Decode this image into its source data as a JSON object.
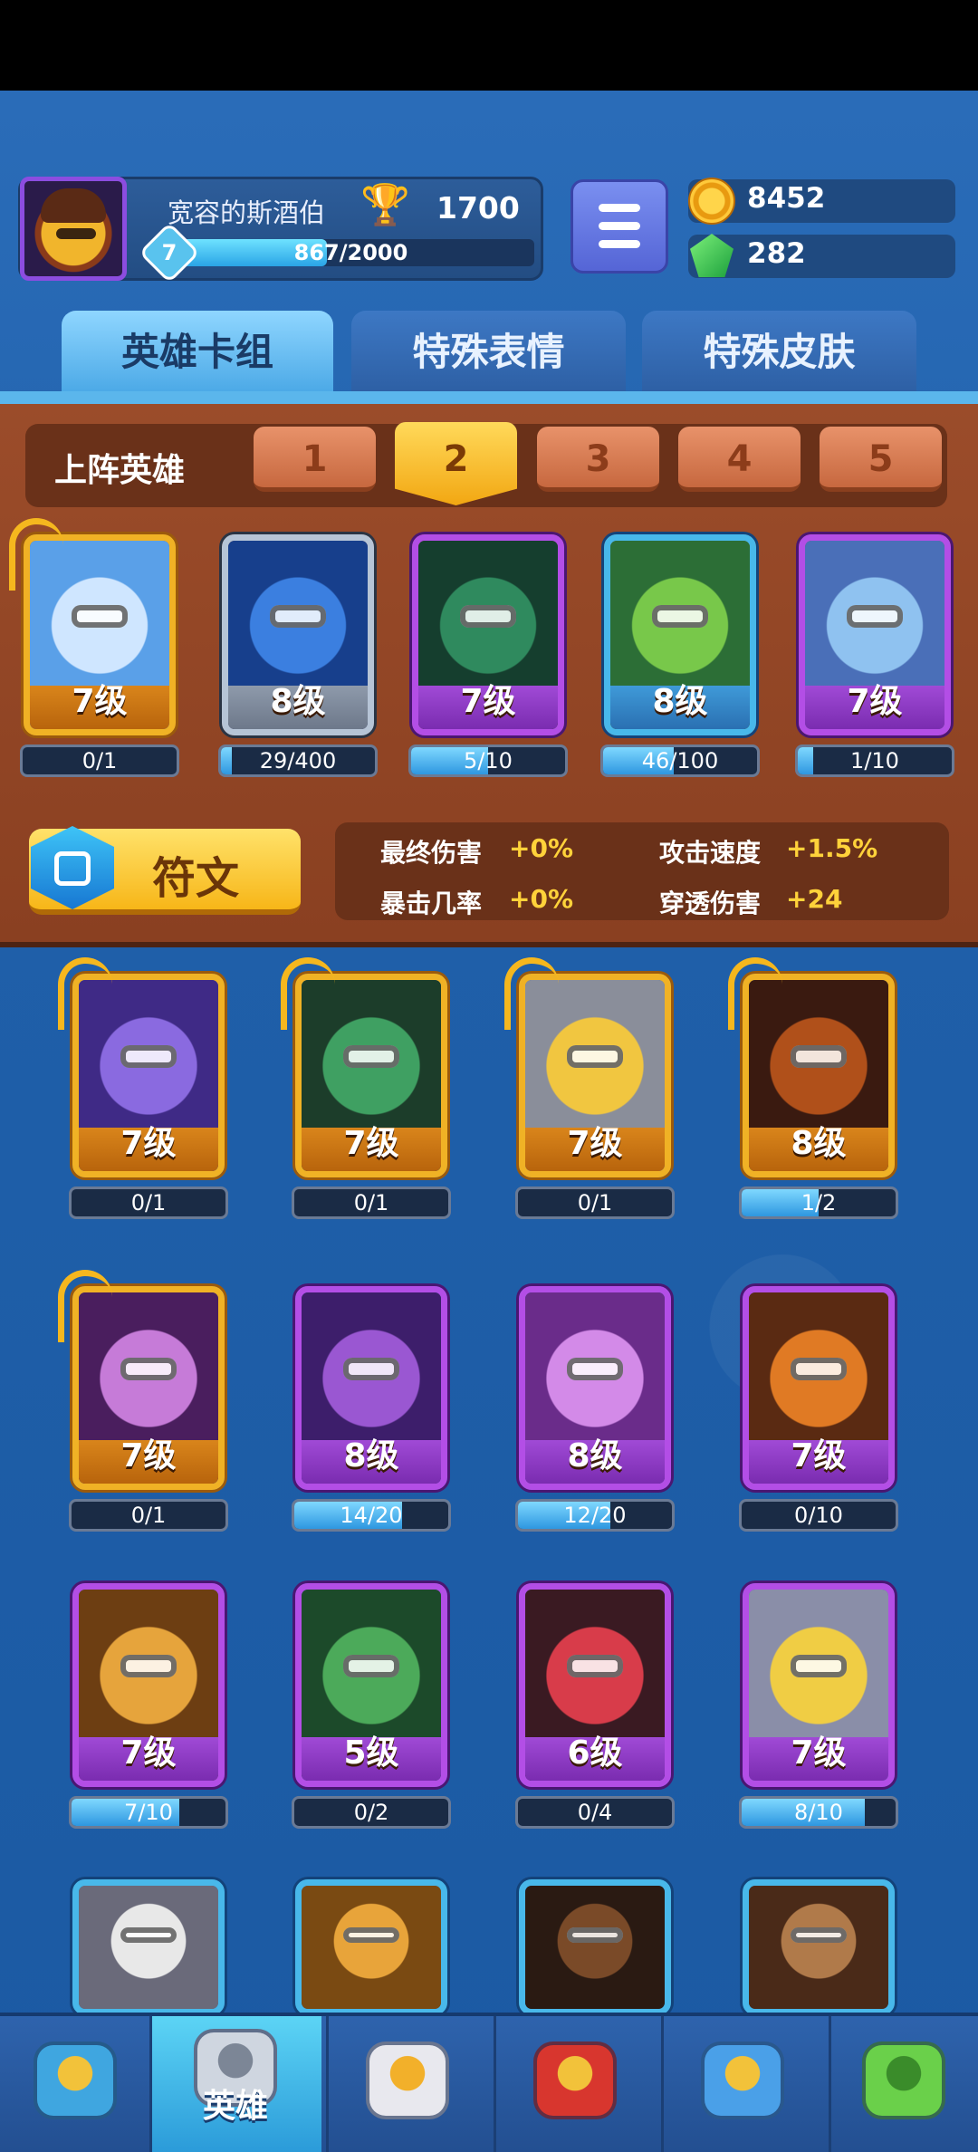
{
  "header": {
    "player_name": "宽容的斯酒伯",
    "trophies": "1700",
    "player_level": "7",
    "xp_text": "867/2000",
    "xp_progress": 0.4335,
    "gold": "8452",
    "gems": "282"
  },
  "tabs": [
    {
      "label": "英雄卡组",
      "active": true
    },
    {
      "label": "特殊表情",
      "active": false
    },
    {
      "label": "特殊皮肤",
      "active": false
    }
  ],
  "deck": {
    "label": "上阵英雄",
    "slots": [
      "1",
      "2",
      "3",
      "4",
      "5"
    ],
    "active_slot": "2"
  },
  "lineup": [
    {
      "level": "7级",
      "progress_text": "0/1",
      "progress": 0,
      "frame": "gold",
      "icon": "yeti-hero-icon"
    },
    {
      "level": "8级",
      "progress_text": "29/400",
      "progress": 0.0725,
      "frame": "gray",
      "icon": "blue-ninja-hero-icon"
    },
    {
      "level": "7级",
      "progress_text": "5/10",
      "progress": 0.5,
      "frame": "purple",
      "icon": "plague-doctor-hero-icon"
    },
    {
      "level": "8级",
      "progress_text": "46/100",
      "progress": 0.46,
      "frame": "blue",
      "icon": "goblin-detective-hero-icon"
    },
    {
      "level": "7级",
      "progress_text": "1/10",
      "progress": 0.1,
      "frame": "purple",
      "icon": "ice-mage-hero-icon"
    }
  ],
  "rune": {
    "label": "符文",
    "stats": [
      {
        "name": "最终伤害",
        "value": "+0%"
      },
      {
        "name": "攻击速度",
        "value": "+1.5%"
      },
      {
        "name": "暴击几率",
        "value": "+0%"
      },
      {
        "name": "穿透伤害",
        "value": "+24"
      }
    ]
  },
  "collection": [
    {
      "level": "7级",
      "progress_text": "0/1",
      "progress": 0,
      "frame": "gold",
      "icon": "octopus-pirate-hero-icon"
    },
    {
      "level": "7级",
      "progress_text": "0/1",
      "progress": 0,
      "frame": "gold",
      "icon": "toxic-goblin-hero-icon"
    },
    {
      "level": "7级",
      "progress_text": "0/1",
      "progress": 0,
      "frame": "gold",
      "icon": "knight-hero-icon"
    },
    {
      "level": "8级",
      "progress_text": "1/2",
      "progress": 0.5,
      "frame": "gold",
      "icon": "lava-golem-hero-icon"
    },
    {
      "level": "7级",
      "progress_text": "0/1",
      "progress": 0,
      "frame": "gold",
      "icon": "skull-reaper-hero-icon"
    },
    {
      "level": "8级",
      "progress_text": "14/20",
      "progress": 0.7,
      "frame": "purple",
      "icon": "magician-hero-icon"
    },
    {
      "level": "8级",
      "progress_text": "12/20",
      "progress": 0.6,
      "frame": "purple",
      "icon": "sorceress-hero-icon"
    },
    {
      "level": "7级",
      "progress_text": "0/10",
      "progress": 0,
      "frame": "purple",
      "icon": "furnace-golem-hero-icon"
    },
    {
      "level": "7级",
      "progress_text": "7/10",
      "progress": 0.7,
      "frame": "purple",
      "icon": "explorer-hero-icon"
    },
    {
      "level": "5级",
      "progress_text": "0/2",
      "progress": 0,
      "frame": "purple",
      "icon": "green-robot-hero-icon"
    },
    {
      "level": "6级",
      "progress_text": "0/4",
      "progress": 0,
      "frame": "purple",
      "icon": "bomb-hero-icon"
    },
    {
      "level": "7级",
      "progress_text": "8/10",
      "progress": 0.8,
      "frame": "purple",
      "icon": "astronaut-hero-icon"
    },
    {
      "level": "",
      "progress_text": "",
      "progress": 0,
      "frame": "blue",
      "icon": "mummy-hero-icon"
    },
    {
      "level": "",
      "progress_text": "",
      "progress": 0,
      "frame": "blue",
      "icon": "gladiator-hero-icon"
    },
    {
      "level": "",
      "progress_text": "",
      "progress": 0,
      "frame": "blue",
      "icon": "cowboy-hero-icon"
    },
    {
      "level": "",
      "progress_text": "",
      "progress": 0,
      "frame": "blue",
      "icon": "ranger-hero-icon"
    }
  ],
  "nav": [
    {
      "label": "",
      "icon": "treasure-chest-icon",
      "active": false
    },
    {
      "label": "英雄",
      "icon": "knight-helmet-icon",
      "active": true
    },
    {
      "label": "",
      "icon": "crossed-swords-icon",
      "active": false
    },
    {
      "label": "",
      "icon": "crown-shield-icon",
      "active": false
    },
    {
      "label": "",
      "icon": "guild-banner-icon",
      "active": false
    },
    {
      "label": "",
      "icon": "sprout-island-icon",
      "active": false
    }
  ],
  "colors": {
    "background": "#1d63b0",
    "wood": "#9b4c2a",
    "gold_accent": "#f0b225",
    "purple_frame": "#b34ee6",
    "stat_value": "#ffd23a"
  }
}
